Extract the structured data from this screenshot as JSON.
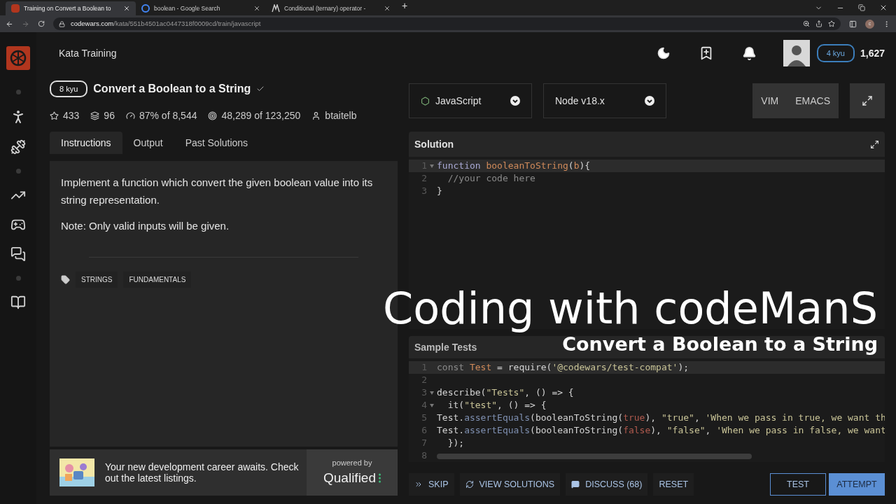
{
  "browser": {
    "tabs": [
      {
        "title": "Training on Convert a Boolean to",
        "selected": true,
        "kind": "codewars"
      },
      {
        "title": "boolean - Google Search",
        "selected": false,
        "kind": "google"
      },
      {
        "title": "Conditional (ternary) operator - ",
        "selected": false,
        "kind": "mdn"
      }
    ],
    "new_tab": "+",
    "url_domain": "codewars.com",
    "url_path": "/kata/551b4501ac0447318f0009cd/train/javascript",
    "profile": "c"
  },
  "header": {
    "title": "Kata Training",
    "rank": "4 kyu",
    "honor": "1,627"
  },
  "kata": {
    "rank": "8 kyu",
    "title": "Convert a Boolean to a String",
    "stats": [
      {
        "kind": "stars",
        "text": "433"
      },
      {
        "kind": "collections",
        "text": "96"
      },
      {
        "kind": "satisfaction",
        "text": "87% of 8,544"
      },
      {
        "kind": "completed",
        "text": "48,289 of 123,250"
      },
      {
        "kind": "author",
        "text": "btaitelb"
      }
    ]
  },
  "tabs": [
    {
      "label": "Instructions",
      "selected": true
    },
    {
      "label": "Output",
      "selected": false
    },
    {
      "label": "Past Solutions",
      "selected": false
    }
  ],
  "description": [
    "Implement a function which convert the given boolean value into its string representation.",
    "Note: Only valid inputs will be given."
  ],
  "tags": [
    "STRINGS",
    "FUNDAMENTALS"
  ],
  "ad": {
    "text": "Your new development career awaits. Check out the latest listings.",
    "powered_by": "powered by",
    "brand": "Qualified"
  },
  "selects": [
    {
      "label": "JavaScript",
      "kind": "language"
    },
    {
      "label": "Node v18.x",
      "kind": "version"
    }
  ],
  "modes": [
    "VIM",
    "EMACS"
  ],
  "solution": {
    "title": "Solution",
    "lines": [
      {
        "number": "1",
        "fold": true,
        "active": true,
        "tokens": [
          {
            "kind": "kw",
            "t": "function "
          },
          {
            "kind": "fn",
            "t": "booleanToString"
          },
          {
            "kind": "plain",
            "t": "("
          },
          {
            "kind": "fn",
            "t": "b"
          },
          {
            "kind": "plain",
            "t": "){"
          }
        ]
      },
      {
        "number": "2",
        "fold": false,
        "active": false,
        "tokens": [
          {
            "kind": "comment",
            "t": "  //your code here"
          }
        ]
      },
      {
        "number": "3",
        "fold": false,
        "active": false,
        "tokens": [
          {
            "kind": "plain",
            "t": "}"
          }
        ]
      }
    ]
  },
  "tests": {
    "title": "Sample Tests",
    "lines": [
      {
        "number": "1",
        "fold": false,
        "active": true,
        "tokens": [
          {
            "kind": "comment",
            "t": "const "
          },
          {
            "kind": "fn",
            "t": "Test"
          },
          {
            "kind": "plain",
            "t": " = require("
          },
          {
            "kind": "str",
            "t": "'@codewars/test-compat'"
          },
          {
            "kind": "plain",
            "t": ");"
          }
        ]
      },
      {
        "number": "2",
        "fold": false,
        "active": false
      },
      {
        "number": "3",
        "fold": true,
        "active": false,
        "tokens": [
          {
            "kind": "plain",
            "t": "describe("
          },
          {
            "kind": "str",
            "t": "\"Tests\""
          },
          {
            "kind": "plain",
            "t": ", () => {"
          }
        ]
      },
      {
        "number": "4",
        "fold": true,
        "active": false,
        "tokens": [
          {
            "kind": "plain",
            "t": "  it("
          },
          {
            "kind": "str",
            "t": "\"test\""
          },
          {
            "kind": "plain",
            "t": ", () => {"
          }
        ]
      },
      {
        "number": "5",
        "fold": false,
        "active": false,
        "tokens": [
          {
            "kind": "plain",
            "t": "Test."
          },
          {
            "kind": "method",
            "t": "assertEquals"
          },
          {
            "kind": "plain",
            "t": "(booleanToString("
          },
          {
            "kind": "bool",
            "t": "true"
          },
          {
            "kind": "plain",
            "t": "), "
          },
          {
            "kind": "str",
            "t": "\"true\""
          },
          {
            "kind": "plain",
            "t": ", "
          },
          {
            "kind": "str",
            "t": "'When we pass in true, we want th"
          }
        ]
      },
      {
        "number": "6",
        "fold": false,
        "active": false,
        "tokens": [
          {
            "kind": "plain",
            "t": "Test."
          },
          {
            "kind": "method",
            "t": "assertEquals"
          },
          {
            "kind": "plain",
            "t": "(booleanToString("
          },
          {
            "kind": "bool",
            "t": "false"
          },
          {
            "kind": "plain",
            "t": "), "
          },
          {
            "kind": "str",
            "t": "\"false\""
          },
          {
            "kind": "plain",
            "t": ", "
          },
          {
            "kind": "str",
            "t": "'When we pass in false, we want"
          }
        ]
      },
      {
        "number": "7",
        "fold": false,
        "active": false,
        "tokens": [
          {
            "kind": "plain",
            "t": "  });"
          }
        ]
      },
      {
        "number": "8",
        "fold": false,
        "active": false
      }
    ]
  },
  "actions": [
    {
      "label": "SKIP",
      "kind": "skip"
    },
    {
      "label": "VIEW SOLUTIONS",
      "kind": "solutions"
    },
    {
      "label": "DISCUSS (68)",
      "kind": "discuss"
    },
    {
      "label": "RESET",
      "kind": "reset"
    }
  ],
  "submit": [
    {
      "label": "TEST",
      "kind": "outline"
    },
    {
      "label": "ATTEMPT",
      "kind": "filled"
    }
  ],
  "overlay": {
    "title": "Coding with codeManS",
    "subtitle": "Convert a Boolean to a String"
  }
}
